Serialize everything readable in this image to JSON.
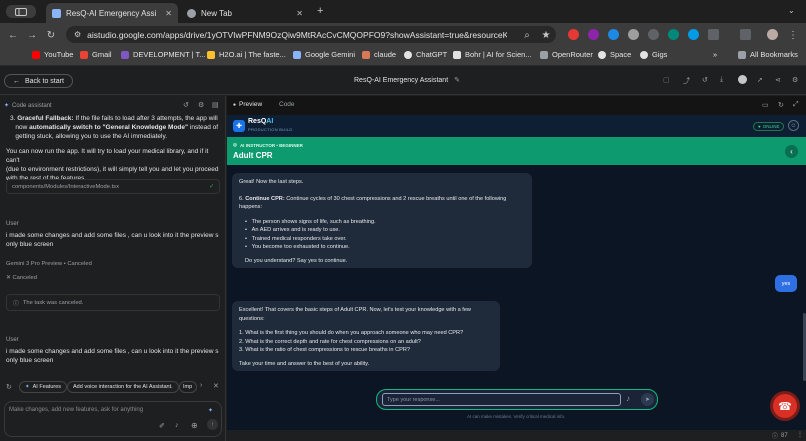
{
  "browser": {
    "tabs": [
      {
        "title": "ResQ-AI Emergency Assi",
        "active": true
      },
      {
        "title": "New Tab",
        "active": false
      }
    ],
    "new_tab_label": "+",
    "url": "aistudio.google.com/apps/drive/1yOTVIwPFNM9OzQiw9MtRAcCvCMQOPFO9?showAssistant=true&resourceKey=...",
    "bookmarks": [
      "YouTube",
      "Gmail",
      "DEVELOPMENT | T...",
      "H2O.ai | The faste...",
      "Google Gemini",
      "claude",
      "ChatGPT",
      "Bohr | AI for Scien...",
      "OpenRouter",
      "Space",
      "Gigs"
    ],
    "all_bookmarks": "All Bookmarks"
  },
  "studio": {
    "back_label": "Back to start",
    "app_title": "ResQ-AI Emergency Assistant",
    "tab_preview": "Preview",
    "tab_code": "Code"
  },
  "assistant": {
    "header": "Code assistant",
    "fallback_num": "3.",
    "fallback_bold": "Graceful Fallback:",
    "fallback_text_1": " If the file fails to load after 3 attempts, the app will",
    "fallback_text_2": "now ",
    "fallback_bold_2": "automatically switch to \"General Knowledge Mode\"",
    "fallback_text_3": " instead of",
    "fallback_text_4": "getting stuck, allowing you to use the AI immediately.",
    "para_1": "You can now run the app. It will try to load your medical library, and if it can't",
    "para_2": "(due to environment restrictions), it will simply tell you and let you proceed",
    "para_3": "with the rest of the features.",
    "file_path": "components/Modules/InteractiveMode.tsx",
    "user_label_1": "User",
    "user_msg_1a": "i made some changes and add some files , can u look into it the preview s",
    "user_msg_1b": "only blue screen",
    "model_label": "Gemini 3 Pro Preview",
    "model_status": "Canceled",
    "canceled_label": "Canceled",
    "canceled_task": "The task was canceled.",
    "user_label_2": "User",
    "user_msg_2a": "i made some changes and add some files , can u look into it the preview s",
    "user_msg_2b": "only blue screen",
    "chips": [
      "AI Features",
      "Add voice interaction for the AI Assistant.",
      "Imp"
    ],
    "input_placeholder": "Make changes, add new features, ask for anything"
  },
  "resq": {
    "logo_line1": "ResQ",
    "logo_line1b": "AI",
    "logo_line2": "PRODUCTION BUILD",
    "online": "ONLINE",
    "instructor": "AI INSTRUCTOR • BEGINNER",
    "module_title": "Adult CPR",
    "msg1": {
      "intro": "Great! Now the last steps.",
      "step_num": "6.",
      "step_bold": "Continue CPR:",
      "step_text": " Continue cycles of 30 chest compressions and 2 rescue breaths until one of the following happens:",
      "bullets": [
        "The person shows signs of life, such as breathing.",
        "An AED arrives and is ready to use.",
        "Trained medical responders take over.",
        "You become too exhausted to continue."
      ],
      "outro": "Do you understand? Say yes to continue."
    },
    "user_reply": "yes",
    "msg2": {
      "intro": "Excellent! That covers the basic steps of Adult CPR. Now, let's test your knowledge with a few questions:",
      "questions": [
        "1.  What is the first thing you should do when you approach someone who may need CPR?",
        "2.  What is the correct depth and rate for chest compressions on an adult?",
        "3.  What is the ratio of chest compressions to rescue breaths in CPR?"
      ],
      "outro": "Take your time and answer to the best of your ability."
    },
    "input_placeholder": "Type your response...",
    "disclaimer": "AI can make mistakes. Verify critical medical info.",
    "zoom": "87"
  }
}
